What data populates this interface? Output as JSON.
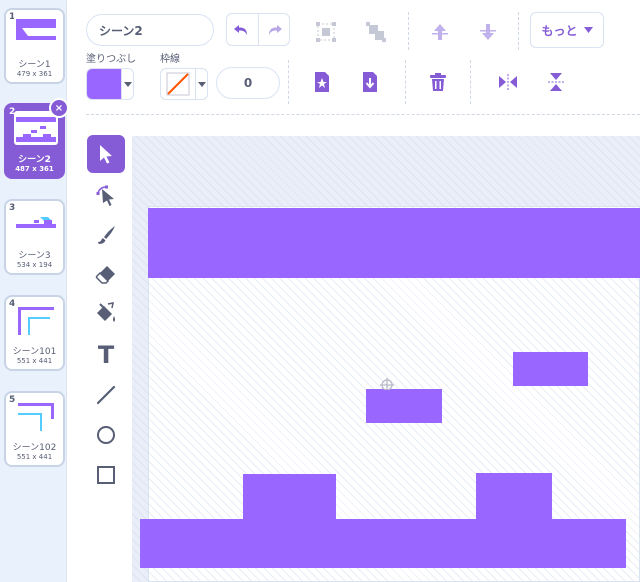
{
  "costumes": [
    {
      "num": "1",
      "name": "シーン1",
      "size": "479 x 361"
    },
    {
      "num": "2",
      "name": "シーン2",
      "size": "487 x 361"
    },
    {
      "num": "3",
      "name": "シーン3",
      "size": "534 x 194"
    },
    {
      "num": "4",
      "name": "シーン101",
      "size": "551 x 441"
    },
    {
      "num": "5",
      "name": "シーン102",
      "size": "551 x 441"
    }
  ],
  "toolbar": {
    "costume_name": "シーン2",
    "more_label": "もっと",
    "fill_label": "塗りつぶし",
    "outline_label": "枠線",
    "outline_width": "0"
  },
  "colors": {
    "accent": "#855cd6",
    "fill": "#9966ff",
    "outline_none": "#ff5500"
  },
  "icons": {
    "delete_costume": "×"
  },
  "tools": [
    "select-icon",
    "reshape-icon",
    "brush-icon",
    "eraser-icon",
    "fill-icon",
    "text-icon",
    "line-icon",
    "circle-icon",
    "rectangle-icon"
  ],
  "text_tool_glyph": "T"
}
